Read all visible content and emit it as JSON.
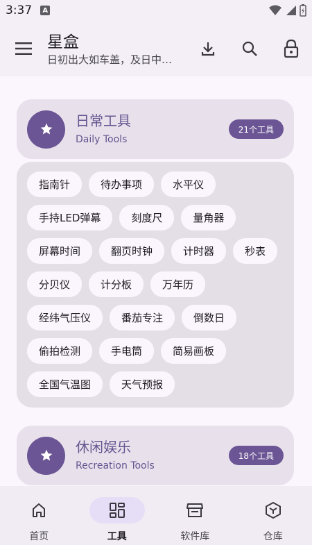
{
  "status": {
    "time": "3:37"
  },
  "appbar": {
    "title": "星盒",
    "subtitle": "日初出大如车盖，及日中…"
  },
  "categories": [
    {
      "title": "日常工具",
      "subtitle": "Daily Tools",
      "badge": "21个工具"
    },
    {
      "title": "休闲娱乐",
      "subtitle": "Recreation Tools",
      "badge": "18个工具"
    }
  ],
  "tools": [
    [
      "指南针",
      "待办事项",
      "水平仪"
    ],
    [
      "手持LED弹幕",
      "刻度尺",
      "量角器"
    ],
    [
      "屏幕时间",
      "翻页时钟",
      "计时器",
      "秒表"
    ],
    [
      "分贝仪",
      "计分板",
      "万年历"
    ],
    [
      "经纬气压仪",
      "番茄专注",
      "倒数日"
    ],
    [
      "偷拍检测",
      "手电筒",
      "简易画板"
    ],
    [
      "全国气温图",
      "天气预报"
    ]
  ],
  "nav": [
    {
      "label": "首页",
      "icon": "home-icon"
    },
    {
      "label": "工具",
      "icon": "tools-grid-icon",
      "active": true
    },
    {
      "label": "软件库",
      "icon": "store-icon"
    },
    {
      "label": "仓库",
      "icon": "box-icon"
    }
  ]
}
